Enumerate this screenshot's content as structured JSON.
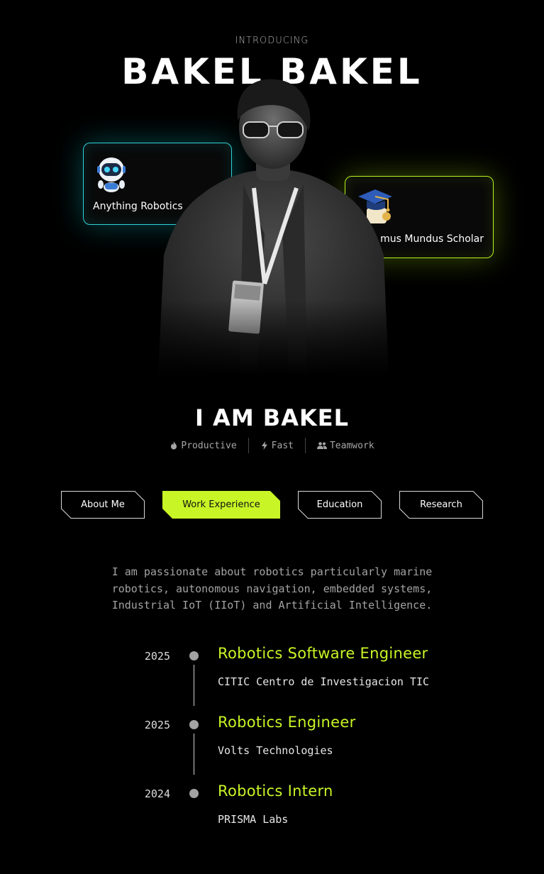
{
  "hero": {
    "intro": "INTRODUCING",
    "name_title": "BAKEL BAKEL"
  },
  "cards": {
    "robotics": {
      "label": "Anything Robotics",
      "icon": "robot-icon",
      "accent": "#2fd3d8"
    },
    "scholar": {
      "label": "mus Mundus Scholar",
      "icon": "graduation-cap-icon",
      "accent": "#b8f21e"
    }
  },
  "intro": {
    "heading": "I AM BAKEL",
    "traits": [
      {
        "icon": "flame-icon",
        "label": "Productive"
      },
      {
        "icon": "bolt-icon",
        "label": "Fast"
      },
      {
        "icon": "users-icon",
        "label": "Teamwork"
      }
    ]
  },
  "tabs": [
    {
      "label": "About Me",
      "active": false
    },
    {
      "label": "Work Experience",
      "active": true
    },
    {
      "label": "Education",
      "active": false
    },
    {
      "label": "Research",
      "active": false
    }
  ],
  "bio": {
    "lines": [
      "I am passionate about robotics particularly marine",
      "robotics, autonomous navigation, embedded systems,",
      "Industrial IoT (IIoT) and Artificial Intelligence."
    ]
  },
  "timeline": [
    {
      "year": "2025",
      "role": "Robotics Software Engineer",
      "org": "CITIC Centro de Investigacion TIC"
    },
    {
      "year": "2025",
      "role": "Robotics Engineer",
      "org": "Volts Technologies"
    },
    {
      "year": "2024",
      "role": "Robotics Intern",
      "org": "PRISMA Labs"
    }
  ],
  "colors": {
    "accent_lime": "#c8f526",
    "accent_cyan": "#2fd3d8",
    "background": "#000000"
  }
}
